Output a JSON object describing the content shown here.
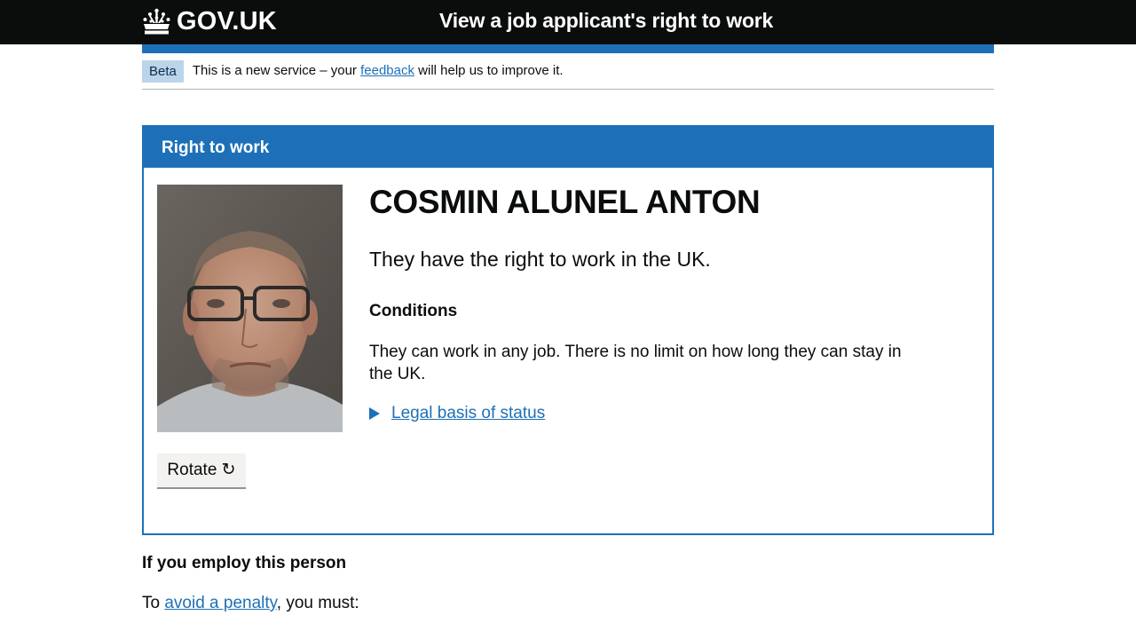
{
  "header": {
    "logo_text": "GOV.UK",
    "service_name": "View a job applicant's right to work"
  },
  "phase_banner": {
    "tag": "Beta",
    "text_before": "This is a new service – your",
    "link": "feedback",
    "text_after": "will help us to improve it."
  },
  "panel": {
    "heading": "Right to work",
    "person_name": "COSMIN ALUNEL ANTON",
    "status": "They have the right to work in the UK.",
    "conditions_title": "Conditions",
    "conditions_text": "They can work in any job. There is no limit on how long they can stay in the UK.",
    "details_link": "Legal basis of status",
    "rotate_button": "Rotate ↻"
  },
  "employ": {
    "title": "If you employ this person",
    "text_before": "To",
    "link": "avoid a penalty",
    "text_after": ", you must:"
  },
  "colors": {
    "brand_blue": "#1d70b8",
    "header_black": "#0b0c0c",
    "phase_tag_bg": "#bbd4ea"
  }
}
